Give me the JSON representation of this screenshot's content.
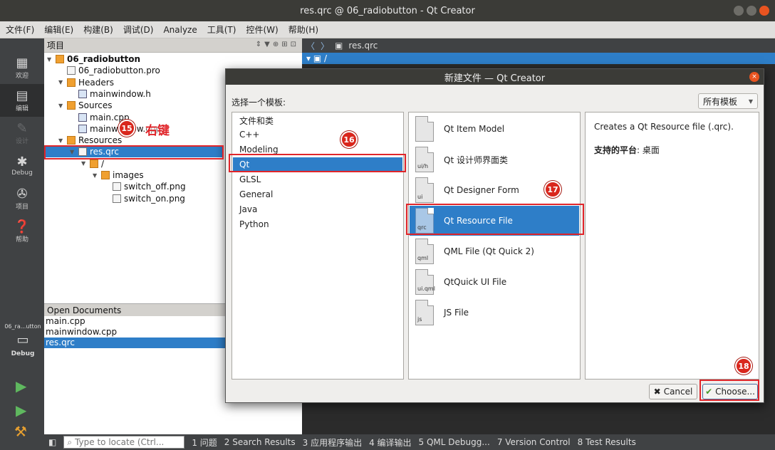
{
  "window": {
    "title": "res.qrc @ 06_radiobutton - Qt Creator"
  },
  "menu": [
    "文件(F)",
    "编辑(E)",
    "构建(B)",
    "调试(D)",
    "Analyze",
    "工具(T)",
    "控件(W)",
    "帮助(H)"
  ],
  "modes": [
    {
      "label": "欢迎",
      "icon": "grid-icon"
    },
    {
      "label": "编辑",
      "icon": "edit-icon"
    },
    {
      "label": "设计",
      "icon": "design-icon"
    },
    {
      "label": "Debug",
      "icon": "bug-icon"
    },
    {
      "label": "项目",
      "icon": "wrench-icon"
    },
    {
      "label": "帮助",
      "icon": "help-icon"
    }
  ],
  "kit": {
    "label": "06_ra...utton",
    "mode": "Debug"
  },
  "project_panel": {
    "title": "项目",
    "tree": [
      {
        "label": "06_radiobutton",
        "indent": 0,
        "icon": "project-icon"
      },
      {
        "label": "06_radiobutton.pro",
        "indent": 1,
        "icon": "pro-file-icon"
      },
      {
        "label": "Headers",
        "indent": 1,
        "icon": "headers-folder-icon"
      },
      {
        "label": "mainwindow.h",
        "indent": 2,
        "icon": "header-file-icon"
      },
      {
        "label": "Sources",
        "indent": 1,
        "icon": "sources-folder-icon"
      },
      {
        "label": "main.cpp",
        "indent": 2,
        "icon": "cpp-file-icon"
      },
      {
        "label": "mainwindow.cpp",
        "indent": 2,
        "icon": "cpp-file-icon"
      },
      {
        "label": "Resources",
        "indent": 1,
        "icon": "resources-folder-icon"
      },
      {
        "label": "res.qrc",
        "indent": 2,
        "icon": "qrc-file-icon",
        "selected": true
      },
      {
        "label": "/",
        "indent": 3,
        "icon": "folder-icon"
      },
      {
        "label": "images",
        "indent": 4,
        "icon": "folder-icon"
      },
      {
        "label": "switch_off.png",
        "indent": 5,
        "icon": "png-file-icon"
      },
      {
        "label": "switch_on.png",
        "indent": 5,
        "icon": "png-file-icon"
      }
    ]
  },
  "open_documents": {
    "title": "Open Documents",
    "items": [
      "main.cpp",
      "mainwindow.cpp",
      "res.qrc"
    ],
    "selected": "res.qrc"
  },
  "editor": {
    "file": "res.qrc",
    "root": "/"
  },
  "statusbar": {
    "locator_placeholder": "Type to locate (Ctrl...",
    "panes": [
      "1 问题",
      "2 Search Results",
      "3 应用程序输出",
      "4 编译输出",
      "5 QML Debugg...",
      "7 Version Control",
      "8 Test Results"
    ]
  },
  "dialog": {
    "title": "新建文件 — Qt Creator",
    "label": "选择一个模板:",
    "filter": "所有模板",
    "categories_header": "文件和类",
    "categories": [
      "C++",
      "Modeling",
      "Qt",
      "GLSL",
      "General",
      "Java",
      "Python"
    ],
    "selected_category": "Qt",
    "templates": [
      {
        "label": "Qt Item Model",
        "tag": ""
      },
      {
        "label": "Qt 设计师界面类",
        "tag": "ui/h"
      },
      {
        "label": "Qt Designer Form",
        "tag": "ui"
      },
      {
        "label": "Qt Resource File",
        "tag": "qrc",
        "selected": true
      },
      {
        "label": "QML File (Qt Quick 2)",
        "tag": "qml"
      },
      {
        "label": "QtQuick UI File",
        "tag": "ui.qml"
      },
      {
        "label": "JS File",
        "tag": "js"
      }
    ],
    "description": "Creates a Qt Resource file (.qrc).",
    "platform_label": "支持的平台",
    "platform_value": ": 桌面",
    "cancel": "Cancel",
    "choose": "Choose..."
  },
  "annotations": {
    "step15": "15",
    "step15_text": "右键",
    "step16": "16",
    "step17": "17",
    "step18": "18",
    "color": "#e0252a"
  }
}
